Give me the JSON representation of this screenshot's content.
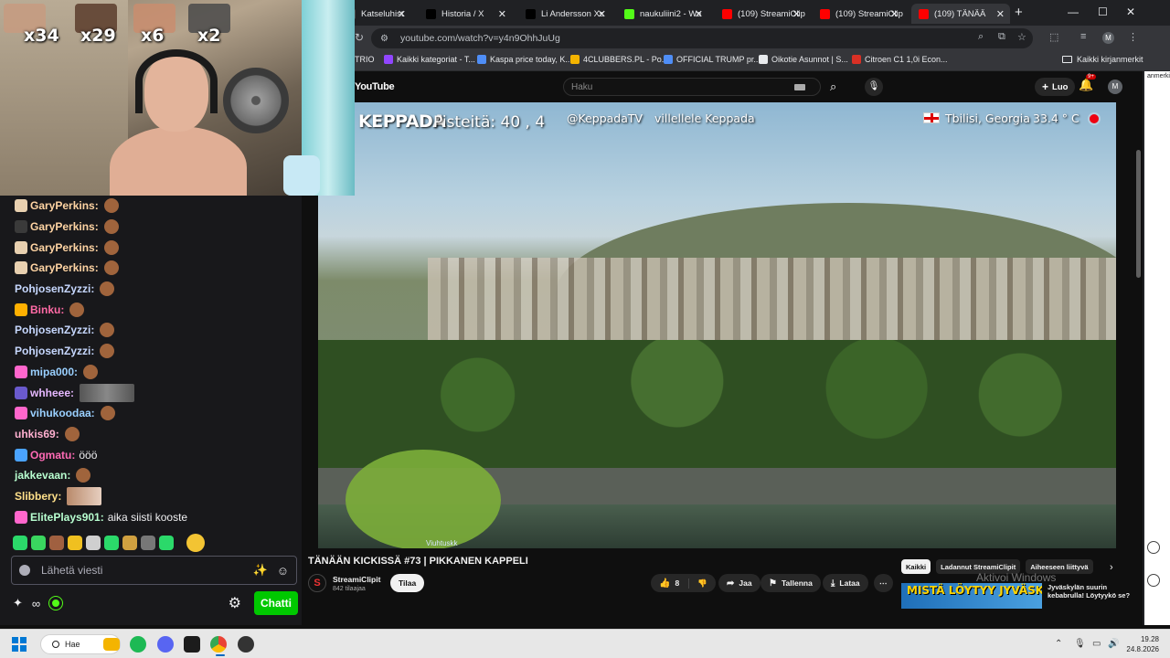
{
  "webcam": {
    "multipliers": [
      "x34",
      "x29",
      "x6",
      "x2"
    ]
  },
  "chat": {
    "messages": [
      {
        "user": "GaryPerkins:",
        "text": "",
        "user_color": "#ffd4a3"
      },
      {
        "user": "GaryPerkins:",
        "text": "",
        "user_color": "#ffd4a3"
      },
      {
        "user": "GaryPerkins:",
        "text": "",
        "user_color": "#ffd4a3"
      },
      {
        "user": "GaryPerkins:",
        "text": "",
        "user_color": "#ffd4a3"
      },
      {
        "user": "PohjosenZyzzi:",
        "text": "",
        "user_color": "#c7d8ff"
      },
      {
        "user": "Binku:",
        "text": "",
        "user_color": "#ff6aa5"
      },
      {
        "user": "PohjosenZyzzi:",
        "text": "",
        "user_color": "#c7d8ff"
      },
      {
        "user": "PohjosenZyzzi:",
        "text": "",
        "user_color": "#c7d8ff"
      },
      {
        "user": "mipa000:",
        "text": "",
        "user_color": "#9ad0ff"
      },
      {
        "user": "whheee:",
        "text": "",
        "user_color": "#e6b8ff"
      },
      {
        "user": "vihukoodaa:",
        "text": "",
        "user_color": "#9ad0ff"
      },
      {
        "user": "uhkis69:",
        "text": "",
        "user_color": "#ffb0d0"
      },
      {
        "user": "Ogmatu:",
        "text": "ööö",
        "user_color": "#ff6ab5"
      },
      {
        "user": "jakkevaan:",
        "text": "",
        "user_color": "#b8ffd0"
      },
      {
        "user": "Slibbery:",
        "text": "",
        "user_color": "#ffe08a"
      },
      {
        "user": "ElitePlays901:",
        "text": "aika siisti kooste",
        "user_color": "#b8ffd0"
      }
    ],
    "input_placeholder": "Lähetä viesti",
    "send_label": "Chatti"
  },
  "browser": {
    "tabs": [
      {
        "title": "Katseluhist",
        "icon_color": "#4a4a4a"
      },
      {
        "title": "Historia / X",
        "icon_color": "#000000"
      },
      {
        "title": "Li Andersson Xs",
        "icon_color": "#000000"
      },
      {
        "title": "naukuliini2 - Wa",
        "icon_color": "#53fc18"
      },
      {
        "title": "(109) StreamiClip",
        "icon_color": "#ff0000"
      },
      {
        "title": "(109) StreamiClip",
        "icon_color": "#ff0000"
      },
      {
        "title": "(109) TÄNÄÄ",
        "icon_color": "#ff0000"
      }
    ],
    "url": "youtube.com/watch?v=y4n9OhhJuUg",
    "bookmarks": [
      {
        "label": "TRIO",
        "icon_color": "#777777"
      },
      {
        "label": "Kaikki kategoriat - T...",
        "icon_color": "#9146ff"
      },
      {
        "label": "Kaspa price today, K...",
        "icon_color": "#4f8ef7"
      },
      {
        "label": "4CLUBBERS.PL - Po...",
        "icon_color": "#f4b400"
      },
      {
        "label": "OFFICIAL TRUMP pr...",
        "icon_color": "#4f8ef7"
      },
      {
        "label": "Oikotie Asunnot | S...",
        "icon_color": "#e8eaed"
      },
      {
        "label": "Citroen C1 1,0i Econ...",
        "icon_color": "#d93025"
      }
    ],
    "bookmarks_folder": "Kaikki kirjanmerkit",
    "side_text": "anmerkit"
  },
  "youtube": {
    "logo": "YouTube",
    "search_placeholder": "Haku",
    "create_label": "Luo",
    "notif_count": "9+",
    "avatar_letter": "M",
    "overlay": {
      "logo": "KEPPADA",
      "score": "Pisteitä: 40 , 4",
      "handle": "@KeppadaTV",
      "via": "villellele  Keppada",
      "location": "Tbilisi, Georgia",
      "temperature": "33.4 ° C",
      "watermark": "Viuhtuskk"
    },
    "video_title": "TÄNÄÄN KICKISSÄ #73 | PIKKANEN KAPPELI",
    "channel": {
      "name": "StreamiClipit",
      "subscribers": "842 tilaajaa",
      "avatar_letter": "S"
    },
    "subscribe_label": "Tilaa",
    "actions": {
      "likes": "8",
      "share": "Jaa",
      "save": "Tallenna",
      "download": "Lataa"
    },
    "chips": [
      "Kaikki",
      "Ladannut StreamiClipit",
      "Aiheeseen liittyvä"
    ],
    "recommended": {
      "thumb_text": "MISTÄ LÖYTYY JYVÄSKYLÄN",
      "title": "Jyväskylän suurin kebabrulla! Löytyykö se?"
    },
    "activate_windows": "Aktivoi Windows"
  },
  "taskbar": {
    "search_label": "Hae",
    "time": "19.28",
    "date": "24.8.2026"
  }
}
